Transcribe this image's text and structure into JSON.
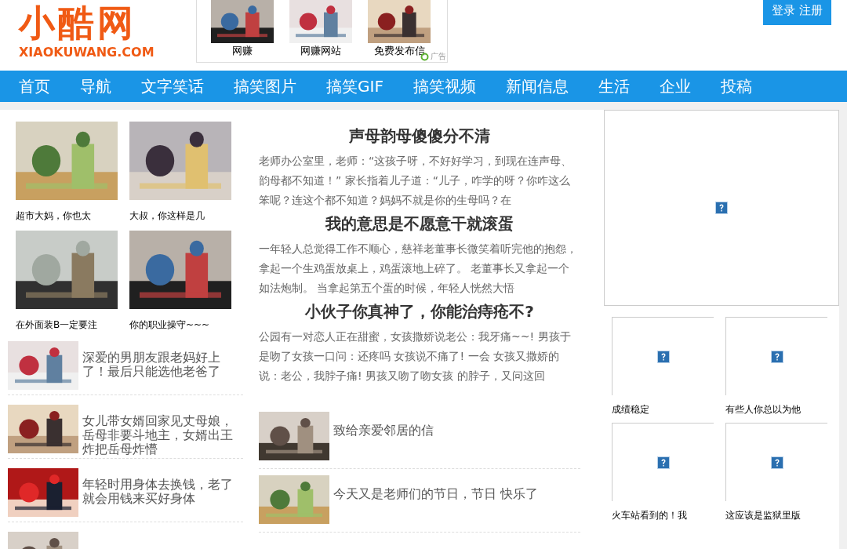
{
  "logo": {
    "title": "小酷网",
    "domain": "XIAOKUWANG.COM"
  },
  "ads": {
    "items": [
      {
        "label": "网赚"
      },
      {
        "label": "网赚网站"
      },
      {
        "label": "免费发布信"
      }
    ],
    "tag": "广告"
  },
  "login": "登录 注册",
  "nav": [
    {
      "label": "首页"
    },
    {
      "label": "导航"
    },
    {
      "label": "文字笑话"
    },
    {
      "label": "搞笑图片"
    },
    {
      "label": "搞笑GIF"
    },
    {
      "label": "搞笑视频"
    },
    {
      "label": "新闻信息"
    },
    {
      "label": "生活"
    },
    {
      "label": "企业"
    },
    {
      "label": "投稿"
    }
  ],
  "gallery": [
    {
      "caption": "超市大妈，你也太"
    },
    {
      "caption": "大叔，你这样是几"
    },
    {
      "caption": "在外面装B一定要注"
    },
    {
      "caption": "你的职业操守~~~"
    }
  ],
  "left_list": [
    {
      "title": "深爱的男朋友跟老妈好上了！最后只能选他老爸了"
    },
    {
      "title": "女儿带女婿回家见丈母娘，岳母非要斗地主，女婿出王炸把岳母炸懵"
    },
    {
      "title": "年轻时用身体去换钱，老了就会用钱来买好身体"
    },
    {
      "kind": "picture"
    }
  ],
  "jokes": [
    {
      "title": "声母韵母傻傻分不清",
      "body": "老师办公室里，老师：“这孩子呀，不好好学习，到现在连声母、韵母都不知道！” 家长指着儿子道：“儿子，咋学的呀？你咋这么笨呢？连这个都不知道？妈妈不就是你的生母吗？在"
    },
    {
      "title": "我的意思是不愿意干就滚蛋",
      "body": "一年轻人总觉得工作不顺心，慈祥老董事长微笑着听完他的抱怨，拿起一个生鸡蛋放桌上，鸡蛋滚地上碎了。 老董事长又拿起一个如法炮制。 当拿起第五个蛋的时候，年轻人恍然大悟"
    },
    {
      "title": "小伙子你真神了，你能治痔疮不?",
      "body": "公园有一对恋人正在甜蜜，女孩撒娇说老公：我牙痛~~! 男孩于是吻了女孩一口问：还疼吗 女孩说不痛了! 一会 女孩又撒娇的说：老公，我脖子痛! 男孩又吻了吻女孩 的脖子，又问这回"
    }
  ],
  "middle_list": [
    {
      "title": "致给亲爱邻居的信"
    },
    {
      "title": "今天又是老师们的节日，节日 快乐了"
    }
  ],
  "right_grid": [
    {
      "caption": "成绩稳定"
    },
    {
      "caption": "有些人你总以为他"
    },
    {
      "caption": "火车站看到的！我"
    },
    {
      "caption": "这应该是监狱里版"
    }
  ]
}
